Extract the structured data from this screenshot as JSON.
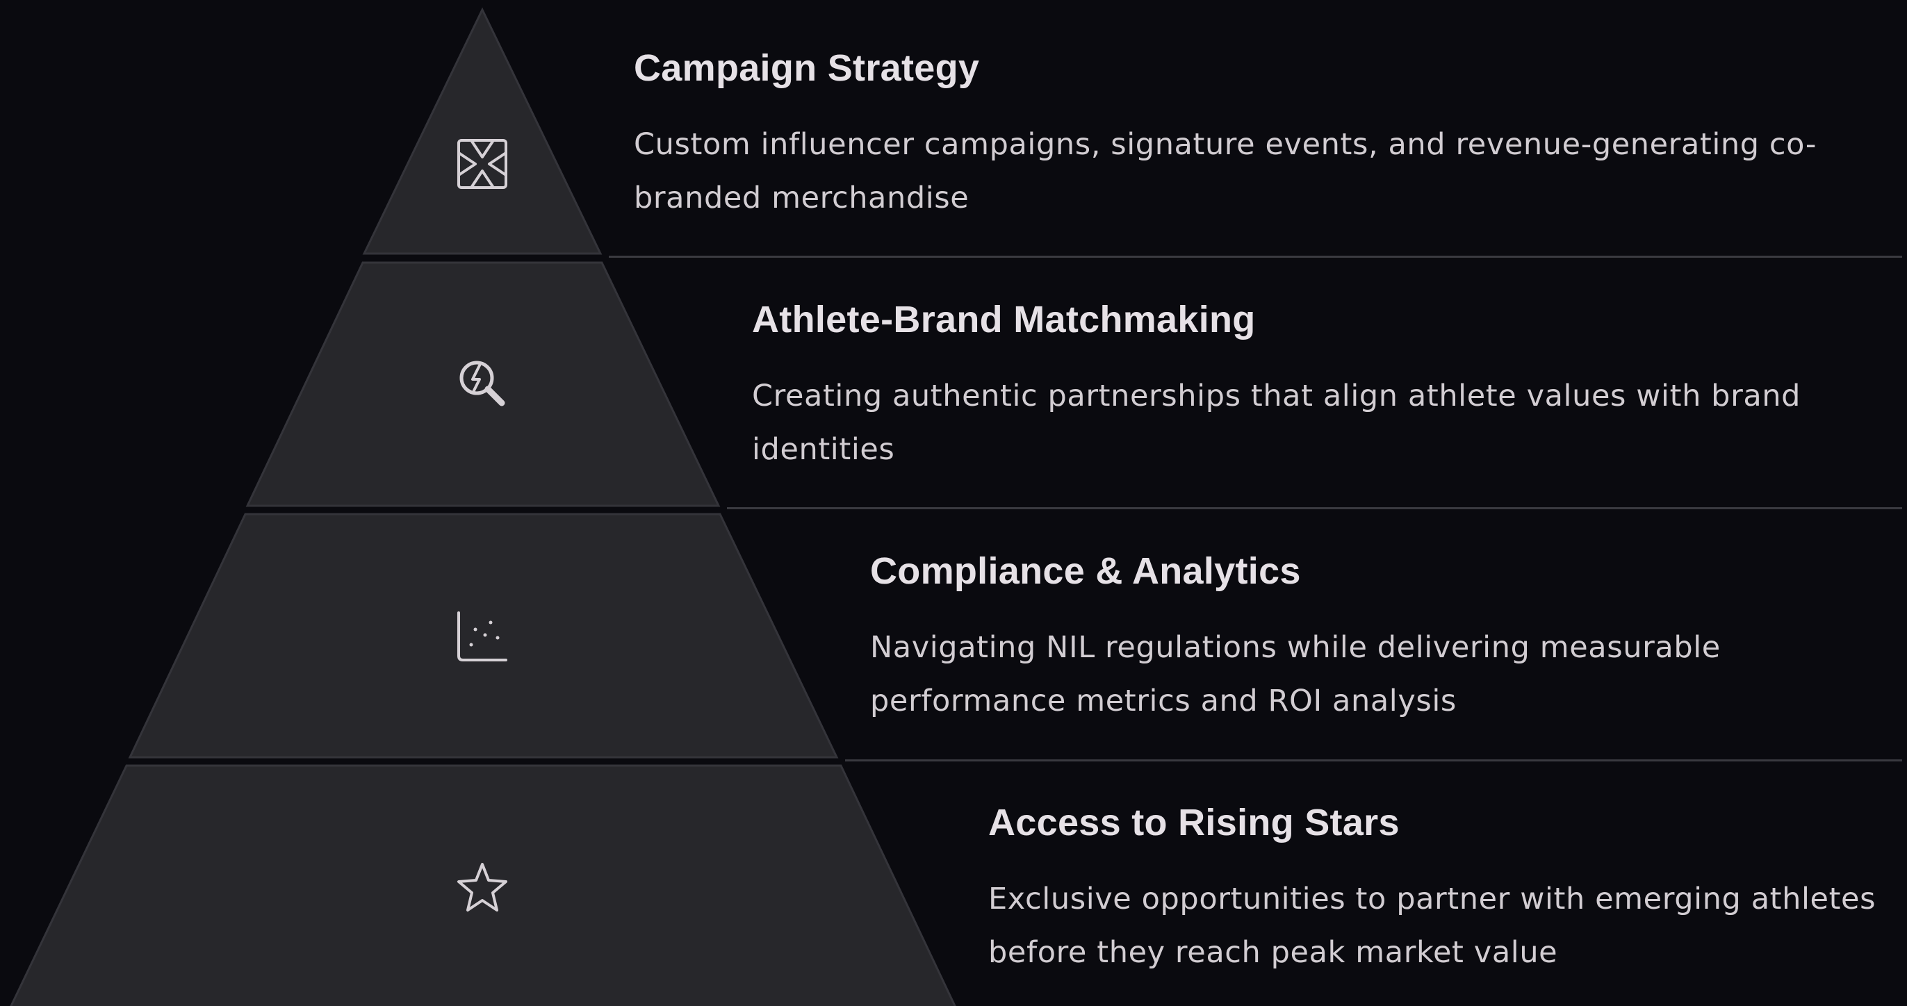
{
  "pyramid": {
    "tiers": [
      {
        "id": "campaign-strategy",
        "icon": "frame-arrows-icon",
        "title": "Campaign Strategy",
        "description": "Custom influencer campaigns, signature events, and revenue-generating co-branded merchandise"
      },
      {
        "id": "athlete-brand-matchmaking",
        "icon": "search-bolt-icon",
        "title": "Athlete-Brand Matchmaking",
        "description": "Creating authentic partnerships that align athlete values with brand identities"
      },
      {
        "id": "compliance-analytics",
        "icon": "scatter-chart-icon",
        "title": "Compliance & Analytics",
        "description": "Navigating NIL regulations while delivering measurable performance metrics and ROI analysis"
      },
      {
        "id": "access-rising-stars",
        "icon": "star-icon",
        "title": "Access to Rising Stars",
        "description": "Exclusive opportunities to partner with emerging athletes before they reach peak market value"
      }
    ]
  },
  "colors": {
    "background": "#0a0a0f",
    "tier_fill": "#27272b",
    "tier_stroke": "#34343a",
    "divider": "#3a3a40",
    "title_text": "#e6e1e6",
    "body_text": "#d2cdd2",
    "icon_stroke": "#d6d1d6"
  }
}
